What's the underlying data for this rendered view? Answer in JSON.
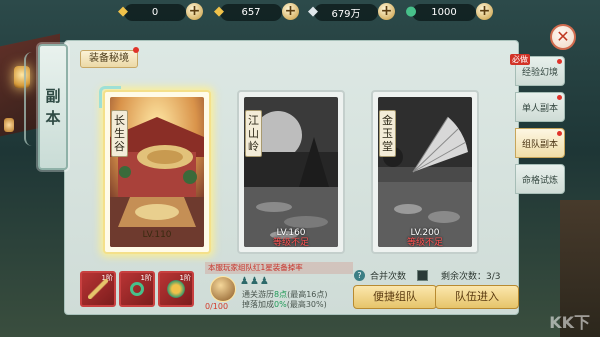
{
  "topbar": {
    "resources": [
      {
        "icon": "gold-ingot-icon",
        "value": "0"
      },
      {
        "icon": "gold-ingot-icon",
        "value": "657"
      },
      {
        "icon": "silver-ingot-icon",
        "value": "679万"
      },
      {
        "icon": "jade-coin-icon",
        "value": "1000"
      }
    ]
  },
  "left_tab": {
    "chars": [
      "副",
      "本"
    ]
  },
  "sub_title": "装备秘境",
  "cards": [
    {
      "name": [
        "长",
        "生",
        "谷"
      ],
      "level": "LV.110",
      "locked": false,
      "lock_text": ""
    },
    {
      "name": [
        "江",
        "山",
        "岭"
      ],
      "level": "LV.160",
      "locked": true,
      "lock_text": "等级不足"
    },
    {
      "name": [
        "金",
        "玉",
        "堂"
      ],
      "level": "LV.200",
      "locked": true,
      "lock_text": "等级不足"
    }
  ],
  "right_tabs": [
    {
      "label": "经验幻境",
      "badge": "必做",
      "active": false
    },
    {
      "label": "单人副本",
      "badge": "",
      "active": false
    },
    {
      "label": "组队副本",
      "badge": "",
      "active": true
    },
    {
      "label": "命格试炼",
      "badge": "",
      "active": false
    }
  ],
  "rewards": [
    {
      "tag": "1阶",
      "icon": "staff-icon"
    },
    {
      "tag": "1阶",
      "icon": "ring-icon"
    },
    {
      "tag": "1阶",
      "icon": "pendant-icon"
    }
  ],
  "team": {
    "banner": "本服玩家组队红1星装备掉率",
    "avatar_count": "0/100",
    "line1_label": "通关游历",
    "line1_value": "8点",
    "line1_max": "(最高16点)",
    "line2_label": "掉落加成",
    "line2_value": "0%",
    "line2_max": "(最高30%)"
  },
  "merge_label": "合并次数",
  "remaining_label": "剩余次数：",
  "remaining_value": "3/3",
  "buttons": {
    "quick_team": "便捷组队",
    "enter": "队伍进入"
  },
  "watermark": "KK下"
}
